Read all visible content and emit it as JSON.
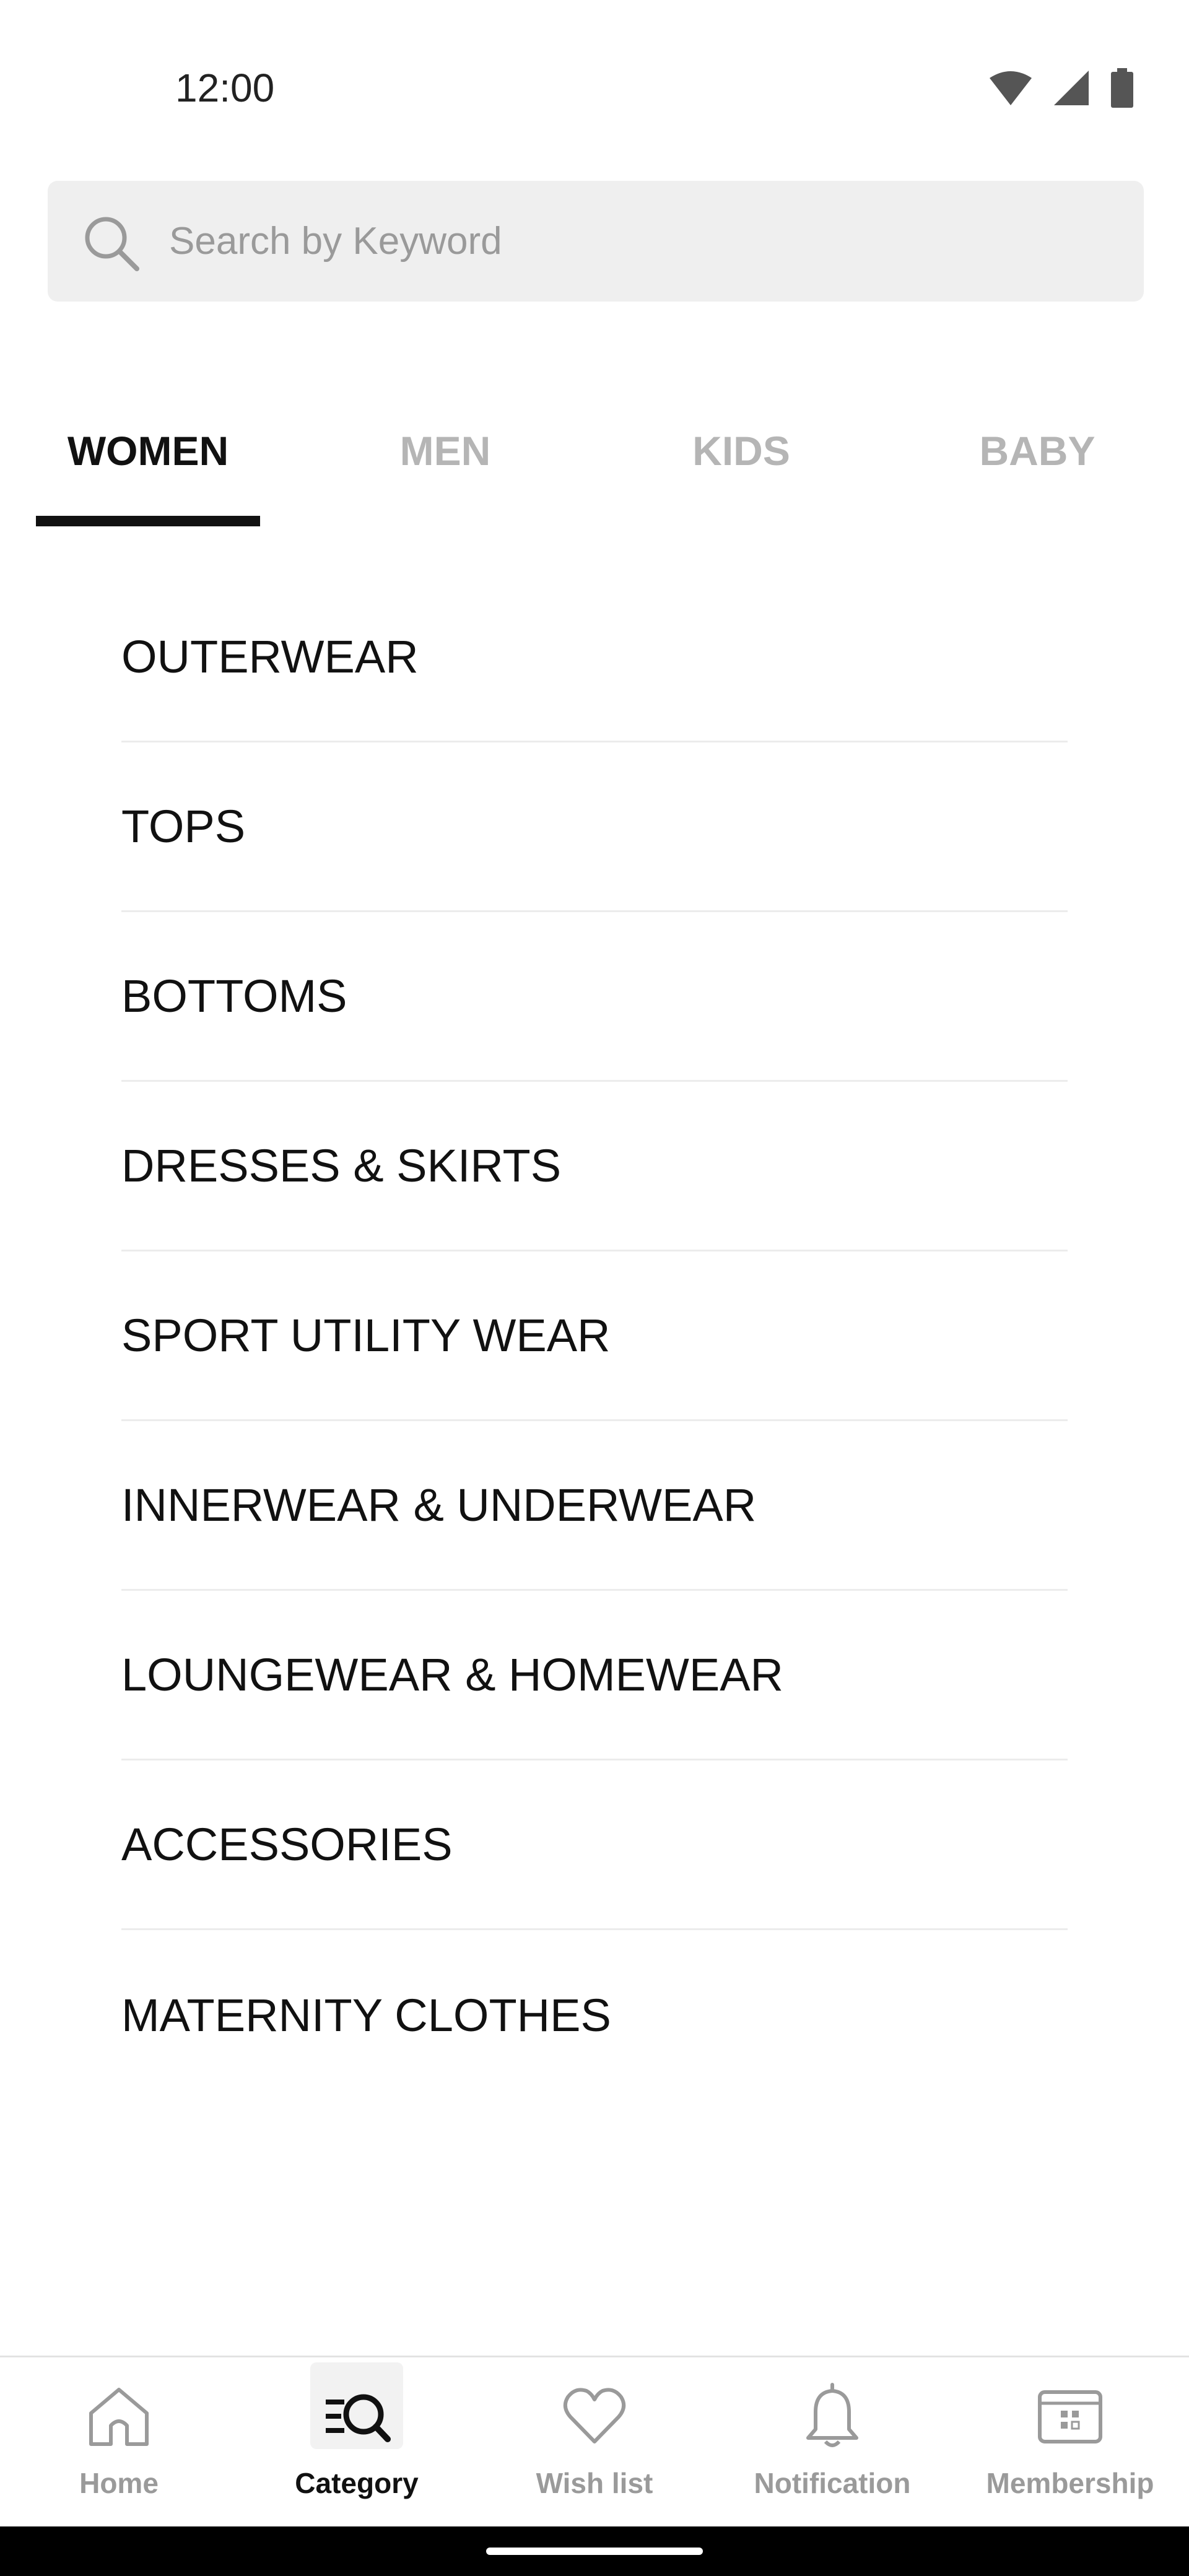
{
  "status_bar": {
    "time": "12:00",
    "icons": [
      "wifi-icon",
      "signal-icon",
      "battery-icon"
    ]
  },
  "search": {
    "placeholder": "Search by Keyword",
    "value": ""
  },
  "tabs": [
    {
      "label": "WOMEN",
      "active": true
    },
    {
      "label": "MEN",
      "active": false
    },
    {
      "label": "KIDS",
      "active": false
    },
    {
      "label": "BABY",
      "active": false
    }
  ],
  "categories": [
    "OUTERWEAR",
    "TOPS",
    "BOTTOMS",
    "DRESSES & SKIRTS",
    "SPORT UTILITY WEAR",
    "INNERWEAR & UNDERWEAR",
    "LOUNGEWEAR & HOMEWEAR",
    "ACCESSORIES",
    "MATERNITY CLOTHES"
  ],
  "bottom_nav": [
    {
      "label": "Home",
      "icon": "home-icon",
      "active": false
    },
    {
      "label": "Category",
      "icon": "category-search-icon",
      "active": true
    },
    {
      "label": "Wish list",
      "icon": "heart-icon",
      "active": false
    },
    {
      "label": "Notification",
      "icon": "bell-icon",
      "active": false
    },
    {
      "label": "Membership",
      "icon": "membership-card-icon",
      "active": false
    }
  ],
  "colors": {
    "active": "#111111",
    "inactive": "#b5b5b5",
    "search_bg": "#efefef",
    "divider": "#ececec"
  }
}
